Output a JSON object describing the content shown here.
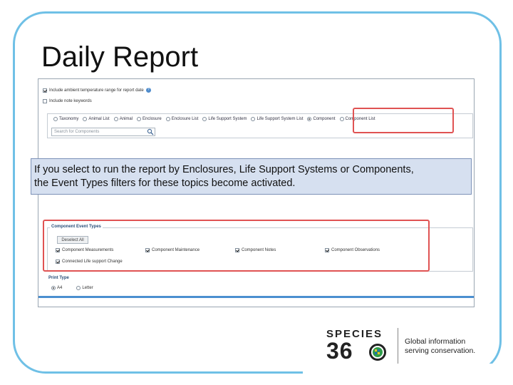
{
  "slide": {
    "title": "Daily Report"
  },
  "options": {
    "ambient_label": "Include ambient temperature range for report date",
    "keywords_label": "Include note keywords"
  },
  "report_by": {
    "items": [
      "Taxonomy",
      "Animal List",
      "Animal",
      "Enclosure",
      "Enclosure List",
      "Life Support System",
      "Life Support System List",
      "Component",
      "Component List"
    ],
    "selected": "Component"
  },
  "search": {
    "placeholder": "Search for Components"
  },
  "callout": {
    "line1": "If you select to run the report by Enclosures, Life Support Systems or Components,",
    "line2": "the Event Types filters for these topics become activated."
  },
  "event_types": {
    "legend": "Component Event Types",
    "deselect_label": "Deselect All",
    "items": [
      "Component Measurements",
      "Component Maintenance",
      "Component Notes",
      "Component Observations",
      "Connected Life support Change"
    ]
  },
  "print_type": {
    "label": "Print Type",
    "options": [
      "A4",
      "Letter"
    ],
    "selected": "A4"
  },
  "logo": {
    "wordmark_top": "SPECIES",
    "wordmark_bottom": "36",
    "tagline_1": "Global information",
    "tagline_2": "serving conservation."
  },
  "colors": {
    "frame": "#6fc0e6",
    "highlight": "#e05353",
    "callout_bg": "#d6e0f0",
    "accent_blue": "#4b8fd0"
  }
}
